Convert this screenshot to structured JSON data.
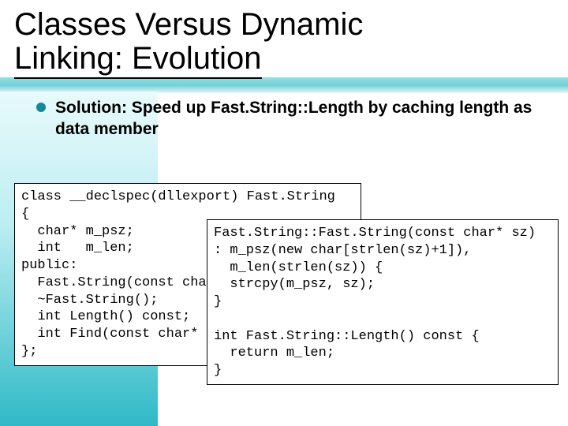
{
  "title": {
    "line1": "Classes Versus Dynamic",
    "line2": "Linking:  Evolution"
  },
  "bullet": "Solution: Speed up Fast.String::Length by caching length as data member",
  "code_left": "class __declspec(dllexport) Fast.String\n{\n  char* m_psz;\n  int   m_len;\npublic:\n  Fast.String(const char* psz);\n  ~Fast.String();\n  int Length() const;\n  int Find(const char* psz);\n};",
  "code_right": "Fast.String::Fast.String(const char* sz)\n: m_psz(new char[strlen(sz)+1]),\n  m_len(strlen(sz)) {\n  strcpy(m_psz, sz);\n}\n\nint Fast.String::Length() const {\n  return m_len;\n}"
}
